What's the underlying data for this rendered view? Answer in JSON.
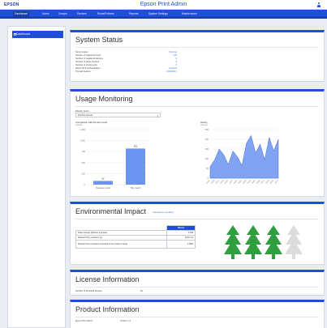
{
  "header": {
    "logo": "EPSON",
    "title": "Epson Print Admin",
    "user_icon": "user-icon"
  },
  "nav": {
    "items": [
      {
        "label": "Dashboard",
        "active": true
      },
      {
        "label": "Users"
      },
      {
        "label": "Groups"
      },
      {
        "label": "Devices"
      },
      {
        "label": "Rules/Policies"
      },
      {
        "label": "Reports"
      },
      {
        "label": "System Settings"
      },
      {
        "label": "Maintenance"
      }
    ]
  },
  "sidebar": {
    "items": [
      {
        "label": "Dashboard",
        "icon": "home-icon"
      }
    ]
  },
  "system_status": {
    "title": "System Status",
    "rows": [
      {
        "label": "Server status",
        "value": "Running"
      },
      {
        "label": "Number of registered users",
        "value": "120"
      },
      {
        "label": "Number of registered devices",
        "value": "3"
      },
      {
        "label": "Number of active devices",
        "value": "3"
      },
      {
        "label": "Number of printing jobs",
        "value": "0"
      },
      {
        "label": "Epson DCP authentication",
        "value": "Enabled"
      },
      {
        "label": "The last backup",
        "value": "2016/05/17"
      }
    ]
  },
  "usage": {
    "title": "Usage Monitoring",
    "display_items_label": "Display items",
    "display_select_value": "Printed sheets",
    "comparison": {
      "title": "Comparison with the last month",
      "unit": "(sheets)",
      "chart_data": {
        "type": "bar",
        "categories": [
          "Previous month",
          "This month"
        ],
        "values": [
          85,
          820
        ],
        "value_labels": [
          "85",
          "820"
        ],
        "ylim": [
          0,
          1250
        ],
        "yticks": [
          "1,250",
          "1,000",
          "750",
          "500",
          "250",
          "0"
        ],
        "color": "#6b93f0"
      }
    },
    "history": {
      "title": "History",
      "unit": "(sheets)",
      "chart_data": {
        "type": "area",
        "x": [
          "04/17",
          "04/19",
          "04/21",
          "04/23",
          "04/25",
          "04/27",
          "04/29",
          "05/01",
          "05/03",
          "05/05",
          "05/07",
          "05/09",
          "05/11",
          "05/13",
          "05/15",
          "05/17"
        ],
        "values": [
          60,
          95,
          150,
          120,
          70,
          140,
          110,
          65,
          180,
          220,
          130,
          175,
          95,
          210,
          140,
          200
        ],
        "ylim": [
          0,
          250
        ],
        "yticks": [
          "250",
          "200",
          "150",
          "100",
          "50",
          "0"
        ],
        "color": "#6b93f0"
      }
    }
  },
  "environment": {
    "title": "Environmental Impact",
    "link": "Calculation condition",
    "table": {
      "header": "Sheets",
      "rows": [
        {
          "label": "Paper savings (Number of sheets)",
          "value": "2,046"
        },
        {
          "label": "Reduced CO₂ emissions (g)",
          "value": "12,311.22"
        },
        {
          "label": "Reduced CO₂ emissions converted to the number of trees",
          "value": "1.3593"
        }
      ]
    },
    "trees": {
      "filled": 3,
      "total": 4,
      "filled_color": "#2e9e3e",
      "empty_color": "#dcdcdc"
    }
  },
  "license": {
    "title": "License Information",
    "rows": [
      {
        "label": "Number of activated devices",
        "value": "20"
      }
    ]
  },
  "product": {
    "title": "Product Information",
    "rows": [
      {
        "label": "Epson Print Admin",
        "value": "Version 1.1"
      }
    ]
  }
}
